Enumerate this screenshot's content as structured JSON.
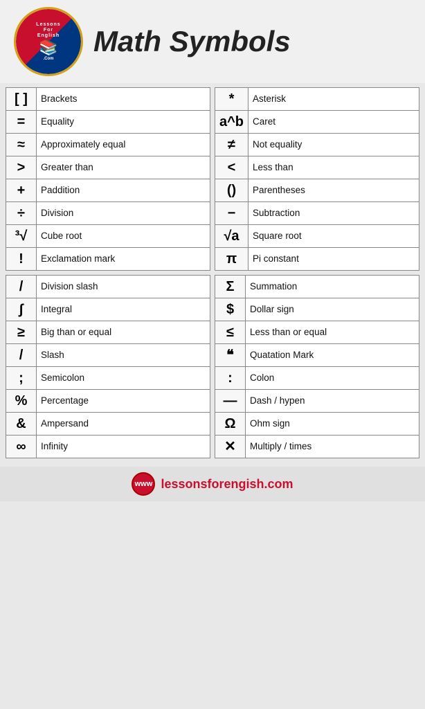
{
  "header": {
    "title": "Math Symbols",
    "logo_top": "LessonsForEnglish",
    "logo_bottom": ".Com",
    "footer_url": "lessonsforengish.com"
  },
  "section1_left": [
    {
      "symbol": "[ ]",
      "label": "Brackets"
    },
    {
      "symbol": "=",
      "label": "Equality"
    },
    {
      "symbol": "≈",
      "label": "Approximately equal"
    },
    {
      "symbol": ">",
      "label": "Greater than"
    },
    {
      "symbol": "+",
      "label": "Paddition"
    },
    {
      "symbol": "÷",
      "label": "Division"
    },
    {
      "symbol": "³√",
      "label": "Cube root"
    },
    {
      "symbol": "!",
      "label": "Exclamation mark"
    }
  ],
  "section1_right": [
    {
      "symbol": "*",
      "label": "Asterisk"
    },
    {
      "symbol": "a^b",
      "label": "Caret"
    },
    {
      "symbol": "≠",
      "label": "Not equality"
    },
    {
      "symbol": "<",
      "label": "Less than"
    },
    {
      "symbol": "()",
      "label": "Parentheses"
    },
    {
      "symbol": "−",
      "label": "Subtraction"
    },
    {
      "symbol": "√a",
      "label": "Square root"
    },
    {
      "symbol": "π",
      "label": "Pi constant"
    }
  ],
  "section2_left": [
    {
      "symbol": "/",
      "label": "Division slash"
    },
    {
      "symbol": "∫",
      "label": "Integral"
    },
    {
      "symbol": "≥",
      "label": "Big than or equal"
    },
    {
      "symbol": "/",
      "label": "Slash"
    },
    {
      "symbol": ";",
      "label": "Semicolon"
    },
    {
      "symbol": "%",
      "label": "Percentage"
    },
    {
      "symbol": "&",
      "label": "Ampersand"
    },
    {
      "symbol": "∞",
      "label": "Infinity"
    }
  ],
  "section2_right": [
    {
      "symbol": "Σ",
      "label": "Summation"
    },
    {
      "symbol": "$",
      "label": "Dollar sign"
    },
    {
      "symbol": "≤",
      "label": "Less than or equal"
    },
    {
      "symbol": "❝",
      "label": "Quatation Mark"
    },
    {
      "symbol": ":",
      "label": "Colon"
    },
    {
      "symbol": "—",
      "label": "Dash / hypen"
    },
    {
      "symbol": "Ω",
      "label": "Ohm sign"
    },
    {
      "symbol": "✕",
      "label": "Multiply / times"
    }
  ],
  "footer": {
    "url": "lessonsforengish.com"
  }
}
